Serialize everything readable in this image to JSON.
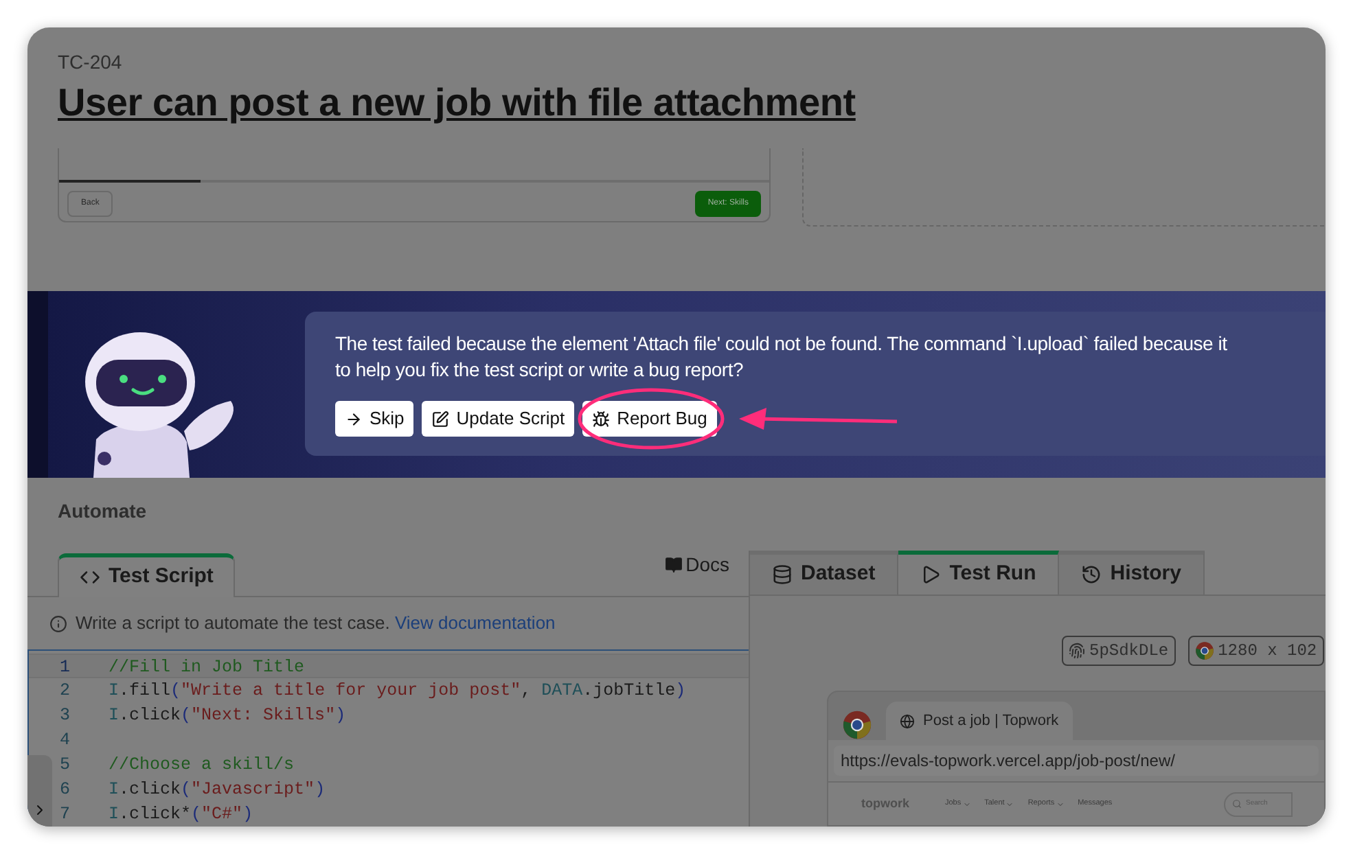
{
  "test_case": {
    "id": "TC-204",
    "title": "User can post a new job with file attachment"
  },
  "form_preview": {
    "back_button": "Back",
    "next_button": "Next: Skills",
    "progress": {
      "level": 0.2
    }
  },
  "assistant": {
    "message_lines": [
      "The test failed because the element 'Attach file' could not be found. The command `I.upload` failed because it",
      "to help you fix the test script or write a bug report?"
    ],
    "actions": [
      {
        "label": "Skip",
        "kind": "skip",
        "highlighted": false
      },
      {
        "label": "Update Script",
        "kind": "edit",
        "highlighted": false
      },
      {
        "label": "Report Bug",
        "kind": "bug",
        "highlighted": true
      }
    ]
  },
  "section_title": "Automate",
  "editor": {
    "tabs": [
      {
        "label": "Test Script",
        "selected": true
      }
    ],
    "docs_link": "Docs",
    "info": {
      "text": "Write a script to automate the test case.",
      "link": "View documentation"
    },
    "lines": [
      {
        "number": "1",
        "active": true,
        "tokens": [
          {
            "kind": "comment",
            "text": "//Fill in Job Title"
          }
        ]
      },
      {
        "number": "2",
        "active": false,
        "tokens": [
          {
            "kind": "ident",
            "text": "I"
          },
          {
            "kind": "plain",
            "text": ".fill"
          },
          {
            "kind": "punct",
            "text": "("
          },
          {
            "kind": "string",
            "text": "\"Write a title for your job post\""
          },
          {
            "kind": "plain",
            "text": ", "
          },
          {
            "kind": "ident",
            "text": "DATA"
          },
          {
            "kind": "plain",
            "text": ".jobTitle"
          },
          {
            "kind": "punct",
            "text": ")"
          }
        ]
      },
      {
        "number": "3",
        "active": false,
        "tokens": [
          {
            "kind": "ident",
            "text": "I"
          },
          {
            "kind": "plain",
            "text": ".click"
          },
          {
            "kind": "punct",
            "text": "("
          },
          {
            "kind": "string",
            "text": "\"Next: Skills\""
          },
          {
            "kind": "punct",
            "text": ")"
          }
        ]
      },
      {
        "number": "4",
        "active": false
      },
      {
        "number": "5",
        "active": false,
        "tokens": [
          {
            "kind": "comment",
            "text": "//Choose a skill/s"
          }
        ]
      },
      {
        "number": "6",
        "active": false,
        "tokens": [
          {
            "kind": "ident",
            "text": "I"
          },
          {
            "kind": "plain",
            "text": ".click"
          },
          {
            "kind": "punct",
            "text": "("
          },
          {
            "kind": "string",
            "text": "\"Javascript\""
          },
          {
            "kind": "punct",
            "text": ")"
          }
        ]
      },
      {
        "number": "7",
        "active": false,
        "tokens": [
          {
            "kind": "ident",
            "text": "I"
          },
          {
            "kind": "plain",
            "text": ".click*"
          },
          {
            "kind": "punct",
            "text": "("
          },
          {
            "kind": "string",
            "text": "\"C#\""
          },
          {
            "kind": "punct",
            "text": ")"
          }
        ]
      }
    ]
  },
  "run_panel": {
    "tabs": [
      {
        "label": "Dataset",
        "kind": "database",
        "selected": false
      },
      {
        "label": "Test Run",
        "kind": "play",
        "selected": true
      },
      {
        "label": "History",
        "kind": "history",
        "selected": false
      }
    ],
    "chips": [
      {
        "kind": "fingerprint",
        "text": "5pSdkDLe"
      },
      {
        "kind": "browser",
        "text": "1280 x 102"
      }
    ],
    "browser": {
      "tab_title": "Post a job | Topwork",
      "url": "https://evals-topwork.vercel.app/job-post/new/",
      "site": {
        "logo": "topwork",
        "nav": [
          {
            "label": "Jobs",
            "dropdown": true
          },
          {
            "label": "Talent",
            "dropdown": true
          },
          {
            "label": "Reports",
            "dropdown": true
          },
          {
            "label": "Messages",
            "dropdown": false
          }
        ],
        "search_placeholder": "Search"
      }
    }
  }
}
